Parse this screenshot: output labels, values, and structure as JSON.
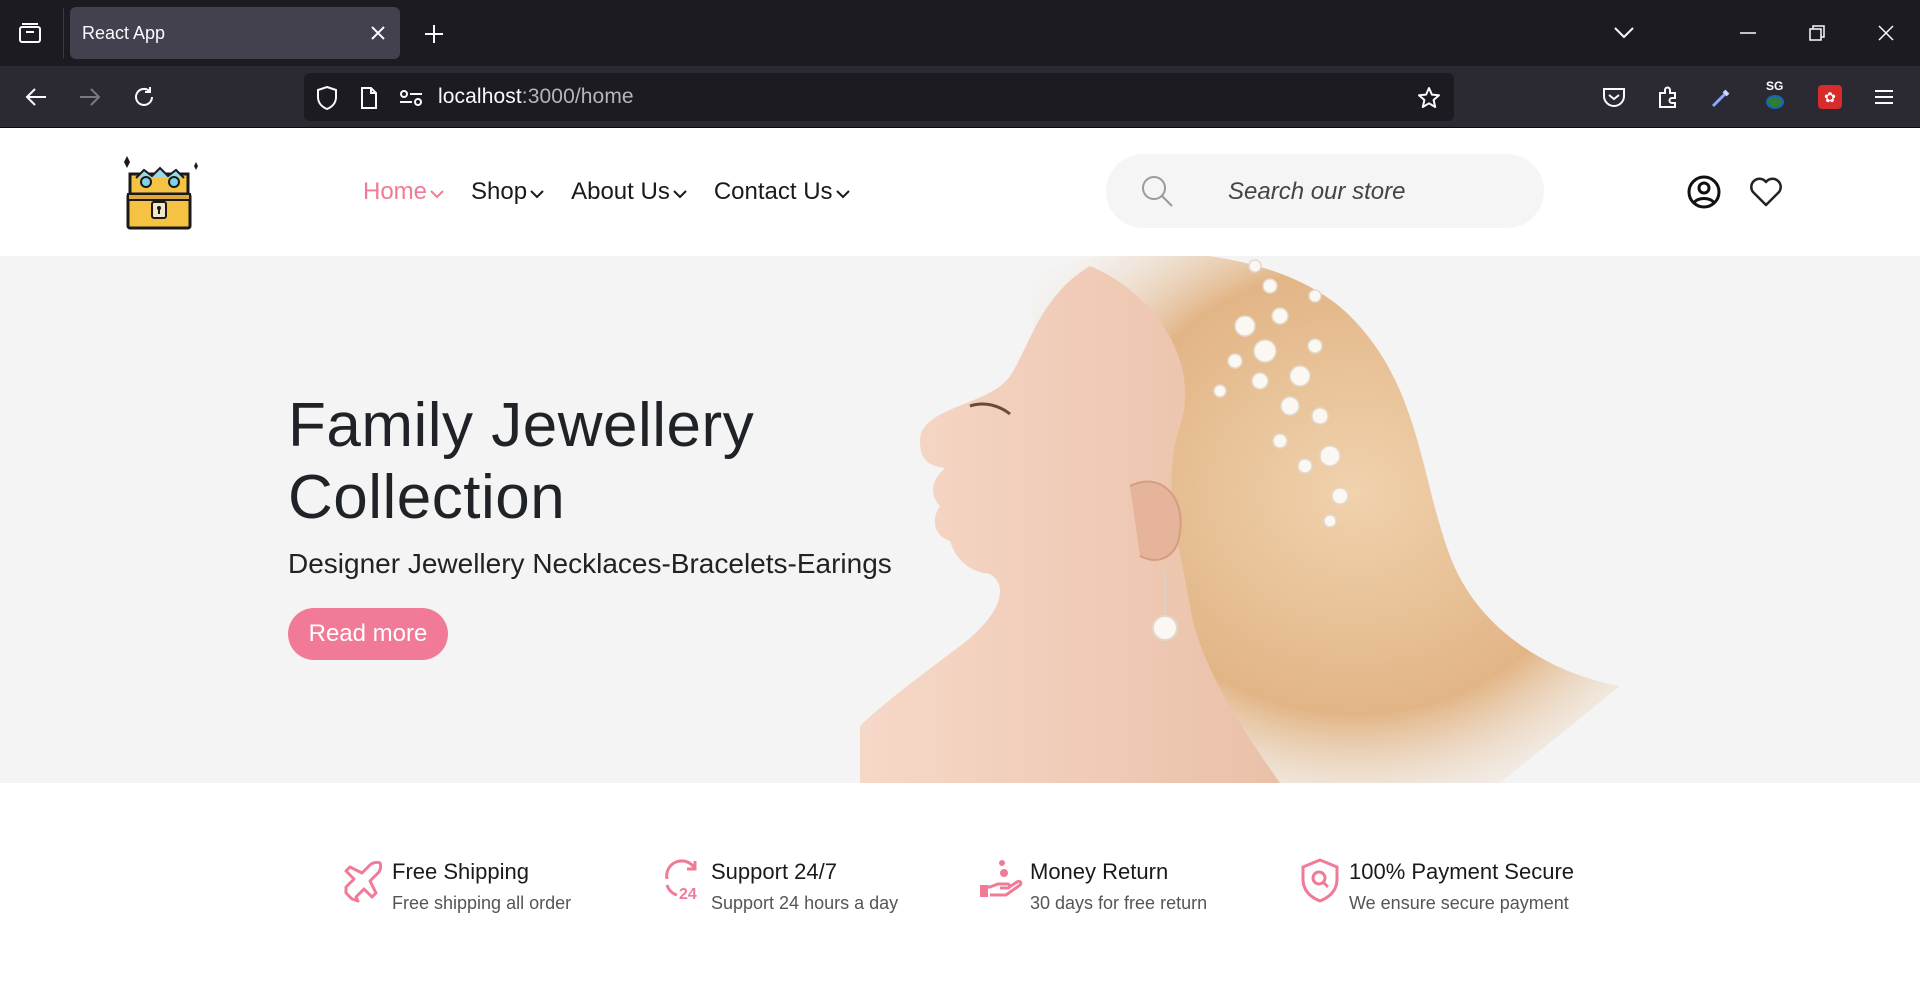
{
  "browser": {
    "tab_title": "React App",
    "url_host": "localhost",
    "url_path": ":3000/home",
    "extension_badge": "SG"
  },
  "header": {
    "nav": [
      {
        "label": "Home",
        "active": true
      },
      {
        "label": "Shop",
        "active": false
      },
      {
        "label": "About Us",
        "active": false
      },
      {
        "label": "Contact Us",
        "active": false
      }
    ],
    "search_placeholder": "Search our store"
  },
  "hero": {
    "title_line1": "Family Jewellery",
    "title_line2": "Collection",
    "subtitle": "Designer Jewellery Necklaces-Bracelets-Earings",
    "button_label": "Read more"
  },
  "features": [
    {
      "icon": "plane-icon",
      "title": "Free Shipping",
      "desc": "Free shipping all order"
    },
    {
      "icon": "support-24-icon",
      "title": "Support 24/7",
      "desc": "Support 24 hours a day"
    },
    {
      "icon": "money-hand-icon",
      "title": "Money Return",
      "desc": "30 days for free return"
    },
    {
      "icon": "shield-search-icon",
      "title": "100% Payment Secure",
      "desc": "We ensure secure payment"
    }
  ],
  "colors": {
    "accent": "#f17b97",
    "hero_bg": "#f4f4f4",
    "browser_dark": "#1c1b22"
  }
}
